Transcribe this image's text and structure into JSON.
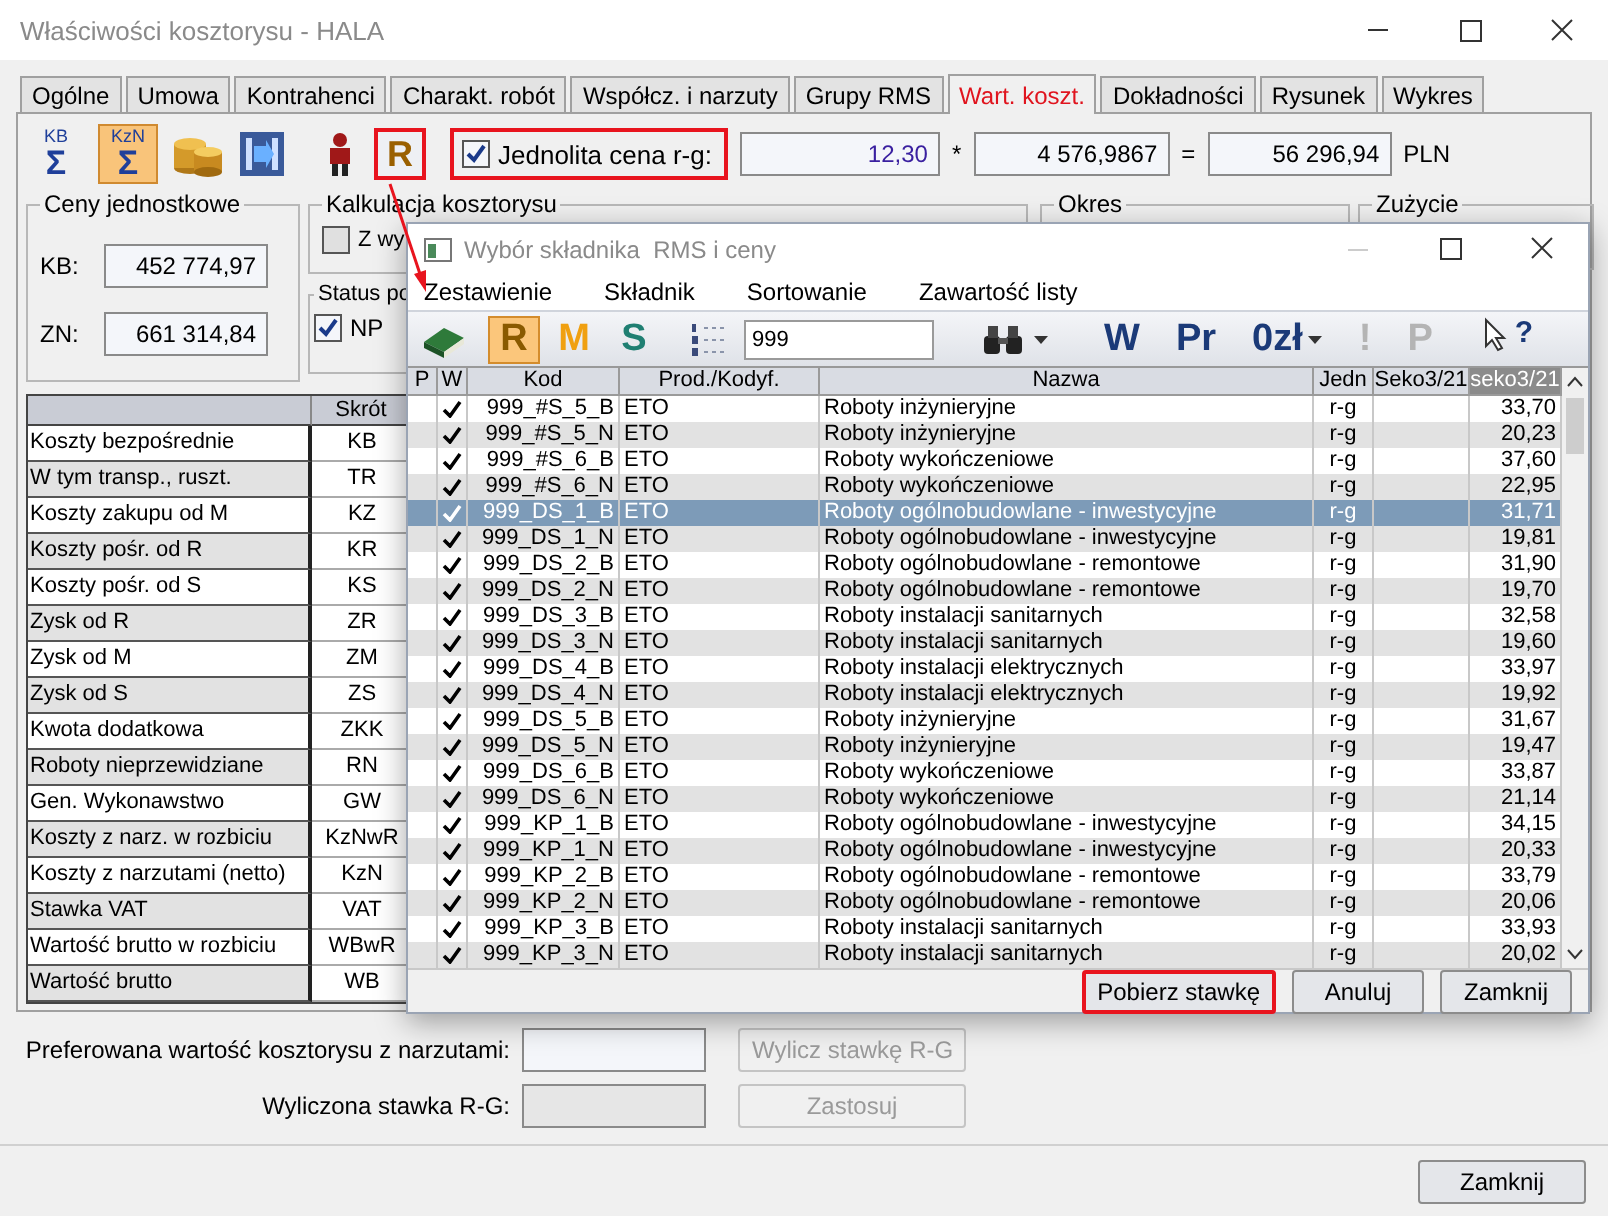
{
  "window": {
    "title": "Właściwości kosztorysu - HALA"
  },
  "tabs": [
    {
      "label": "Ogólne",
      "selected": false
    },
    {
      "label": "Umowa",
      "selected": false
    },
    {
      "label": "Kontrahenci",
      "selected": false
    },
    {
      "label": "Charakt. robót",
      "selected": false
    },
    {
      "label": "Współcz. i narzuty",
      "selected": false
    },
    {
      "label": "Grupy RMS",
      "selected": false
    },
    {
      "label": "Wart. koszt.",
      "selected": true
    },
    {
      "label": "Dokładności",
      "selected": false
    },
    {
      "label": "Rysunek",
      "selected": false
    },
    {
      "label": "Wykres",
      "selected": false
    }
  ],
  "toolbar": {
    "sum_buttons": [
      {
        "caption": "KB",
        "symbol": "Σ",
        "selected": false
      },
      {
        "caption": "KzN",
        "symbol": "Σ",
        "selected": true
      }
    ],
    "rate_button": {
      "label": "R",
      "highlighted": true
    },
    "uniform_rate": {
      "label": "Jednolita cena r-g:",
      "checked": true,
      "highlighted": true,
      "value": "12,30"
    },
    "times": "*",
    "quantity": "4 576,9867",
    "equals": "=",
    "total": "56 296,94",
    "currency": "PLN"
  },
  "unit_prices": {
    "title": "Ceny jednostkowe",
    "fields": [
      {
        "label": "KB:",
        "value": "452 774,97"
      },
      {
        "label": "ZN:",
        "value": "661 314,84"
      }
    ]
  },
  "calculation": {
    "title": "Kalkulacja kosztorysu",
    "option": {
      "label": "Z wy",
      "checked": false
    }
  },
  "status": {
    "title": "Status po",
    "option": {
      "label": "NP",
      "checked": true
    }
  },
  "period": {
    "title": "Okres"
  },
  "usage": {
    "title": "Zużycie"
  },
  "cost_table": {
    "columns": [
      "Skrót"
    ],
    "rows": [
      {
        "name": "Koszty bezpośrednie",
        "code": "KB"
      },
      {
        "name": "W tym transp., ruszt.",
        "code": "TR"
      },
      {
        "name": "Koszty zakupu od M",
        "code": "KZ"
      },
      {
        "name": "Koszty pośr. od R",
        "code": "KR"
      },
      {
        "name": "Koszty pośr. od S",
        "code": "KS"
      },
      {
        "name": "Zysk od R",
        "code": "ZR"
      },
      {
        "name": "Zysk od M",
        "code": "ZM"
      },
      {
        "name": "Zysk od S",
        "code": "ZS"
      },
      {
        "name": "Kwota dodatkowa",
        "code": "ZKK"
      },
      {
        "name": "Roboty nieprzewidziane",
        "code": "RN"
      },
      {
        "name": "Gen. Wykonawstwo",
        "code": "GW"
      },
      {
        "name": "Koszty z narz. w rozbiciu",
        "code": "KzNwR"
      },
      {
        "name": "Koszty z narzutami (netto)",
        "code": "KzN"
      },
      {
        "name": "Stawka VAT",
        "code": "VAT"
      },
      {
        "name": "Wartość brutto w rozbiciu",
        "code": "WBwR"
      },
      {
        "name": "Wartość brutto",
        "code": "WB"
      }
    ]
  },
  "rate_form": {
    "preferred_label": "Preferowana wartość kosztorysu z narzutami:",
    "compute_button": {
      "label": "Wylicz stawkę R-G",
      "disabled": true
    },
    "computed_label": "Wyliczona stawka R-G:",
    "apply_button": {
      "label": "Zastosuj",
      "disabled": true
    }
  },
  "dialog": {
    "title": "Wybór składnika  RMS i ceny",
    "menu": [
      "Zestawienie",
      "Składnik",
      "Sortowanie",
      "Zawartość listy"
    ],
    "filters": [
      {
        "label": "R",
        "color": "#8a5a00",
        "selected": true
      },
      {
        "label": "M",
        "color": "#f0a010",
        "selected": false
      },
      {
        "label": "S",
        "color": "#1f7f72",
        "selected": false
      }
    ],
    "search": "999",
    "actions": [
      {
        "label": "W",
        "disabled": false,
        "dropdown": false
      },
      {
        "label": "Pr",
        "disabled": false,
        "dropdown": false
      },
      {
        "label": "0zł",
        "disabled": false,
        "dropdown": true
      },
      {
        "label": "!",
        "disabled": true,
        "dropdown": false
      },
      {
        "label": "P",
        "disabled": true,
        "dropdown": false
      }
    ],
    "help": "?",
    "columns": [
      {
        "label": "P",
        "sorted": false
      },
      {
        "label": "W",
        "sorted": false
      },
      {
        "label": "Kod",
        "sorted": false
      },
      {
        "label": "Prod./Kodyf.",
        "sorted": false
      },
      {
        "label": "Nazwa",
        "sorted": false
      },
      {
        "label": "Jedn",
        "sorted": false
      },
      {
        "label": "Seko3/21",
        "sorted": false
      },
      {
        "label": "seko3/21",
        "sorted": true
      }
    ],
    "rows": [
      {
        "checked": true,
        "code": "999_#S_5_B",
        "prod": "ETO",
        "name": "Roboty inżynieryjne",
        "unit": "r-g",
        "value": "33,70",
        "selected": false
      },
      {
        "checked": true,
        "code": "999_#S_5_N",
        "prod": "ETO",
        "name": "Roboty inżynieryjne",
        "unit": "r-g",
        "value": "20,23",
        "selected": false
      },
      {
        "checked": true,
        "code": "999_#S_6_B",
        "prod": "ETO",
        "name": "Roboty wykończeniowe",
        "unit": "r-g",
        "value": "37,60",
        "selected": false
      },
      {
        "checked": true,
        "code": "999_#S_6_N",
        "prod": "ETO",
        "name": "Roboty wykończeniowe",
        "unit": "r-g",
        "value": "22,95",
        "selected": false
      },
      {
        "checked": true,
        "code": "999_DS_1_B",
        "prod": "ETO",
        "name": "Roboty ogólnobudowlane - inwestycyjne",
        "unit": "r-g",
        "value": "31,71",
        "selected": true
      },
      {
        "checked": true,
        "code": "999_DS_1_N",
        "prod": "ETO",
        "name": "Roboty ogólnobudowlane - inwestycyjne",
        "unit": "r-g",
        "value": "19,81",
        "selected": false
      },
      {
        "checked": true,
        "code": "999_DS_2_B",
        "prod": "ETO",
        "name": "Roboty ogólnobudowlane - remontowe",
        "unit": "r-g",
        "value": "31,90",
        "selected": false
      },
      {
        "checked": true,
        "code": "999_DS_2_N",
        "prod": "ETO",
        "name": "Roboty ogólnobudowlane - remontowe",
        "unit": "r-g",
        "value": "19,70",
        "selected": false
      },
      {
        "checked": true,
        "code": "999_DS_3_B",
        "prod": "ETO",
        "name": "Roboty instalacji sanitarnych",
        "unit": "r-g",
        "value": "32,58",
        "selected": false
      },
      {
        "checked": true,
        "code": "999_DS_3_N",
        "prod": "ETO",
        "name": "Roboty instalacji sanitarnych",
        "unit": "r-g",
        "value": "19,60",
        "selected": false
      },
      {
        "checked": true,
        "code": "999_DS_4_B",
        "prod": "ETO",
        "name": "Roboty instalacji elektrycznych",
        "unit": "r-g",
        "value": "33,97",
        "selected": false
      },
      {
        "checked": true,
        "code": "999_DS_4_N",
        "prod": "ETO",
        "name": "Roboty instalacji elektrycznych",
        "unit": "r-g",
        "value": "19,92",
        "selected": false
      },
      {
        "checked": true,
        "code": "999_DS_5_B",
        "prod": "ETO",
        "name": "Roboty inżynieryjne",
        "unit": "r-g",
        "value": "31,67",
        "selected": false
      },
      {
        "checked": true,
        "code": "999_DS_5_N",
        "prod": "ETO",
        "name": "Roboty inżynieryjne",
        "unit": "r-g",
        "value": "19,47",
        "selected": false
      },
      {
        "checked": true,
        "code": "999_DS_6_B",
        "prod": "ETO",
        "name": "Roboty wykończeniowe",
        "unit": "r-g",
        "value": "33,87",
        "selected": false
      },
      {
        "checked": true,
        "code": "999_DS_6_N",
        "prod": "ETO",
        "name": "Roboty wykończeniowe",
        "unit": "r-g",
        "value": "21,14",
        "selected": false
      },
      {
        "checked": true,
        "code": "999_KP_1_B",
        "prod": "ETO",
        "name": "Roboty ogólnobudowlane - inwestycyjne",
        "unit": "r-g",
        "value": "34,15",
        "selected": false
      },
      {
        "checked": true,
        "code": "999_KP_1_N",
        "prod": "ETO",
        "name": "Roboty ogólnobudowlane - inwestycyjne",
        "unit": "r-g",
        "value": "20,33",
        "selected": false
      },
      {
        "checked": true,
        "code": "999_KP_2_B",
        "prod": "ETO",
        "name": "Roboty ogólnobudowlane - remontowe",
        "unit": "r-g",
        "value": "33,79",
        "selected": false
      },
      {
        "checked": true,
        "code": "999_KP_2_N",
        "prod": "ETO",
        "name": "Roboty ogólnobudowlane - remontowe",
        "unit": "r-g",
        "value": "20,06",
        "selected": false
      },
      {
        "checked": true,
        "code": "999_KP_3_B",
        "prod": "ETO",
        "name": "Roboty instalacji sanitarnych",
        "unit": "r-g",
        "value": "33,93",
        "selected": false
      },
      {
        "checked": true,
        "code": "999_KP_3_N",
        "prod": "ETO",
        "name": "Roboty instalacji sanitarnych",
        "unit": "r-g",
        "value": "20,02",
        "selected": false
      }
    ],
    "buttons": [
      {
        "label": "Pobierz stawkę",
        "highlighted": true
      },
      {
        "label": "Anuluj",
        "highlighted": false
      },
      {
        "label": "Zamknij",
        "highlighted": false
      }
    ]
  },
  "footer": {
    "close": "Zamknij"
  }
}
